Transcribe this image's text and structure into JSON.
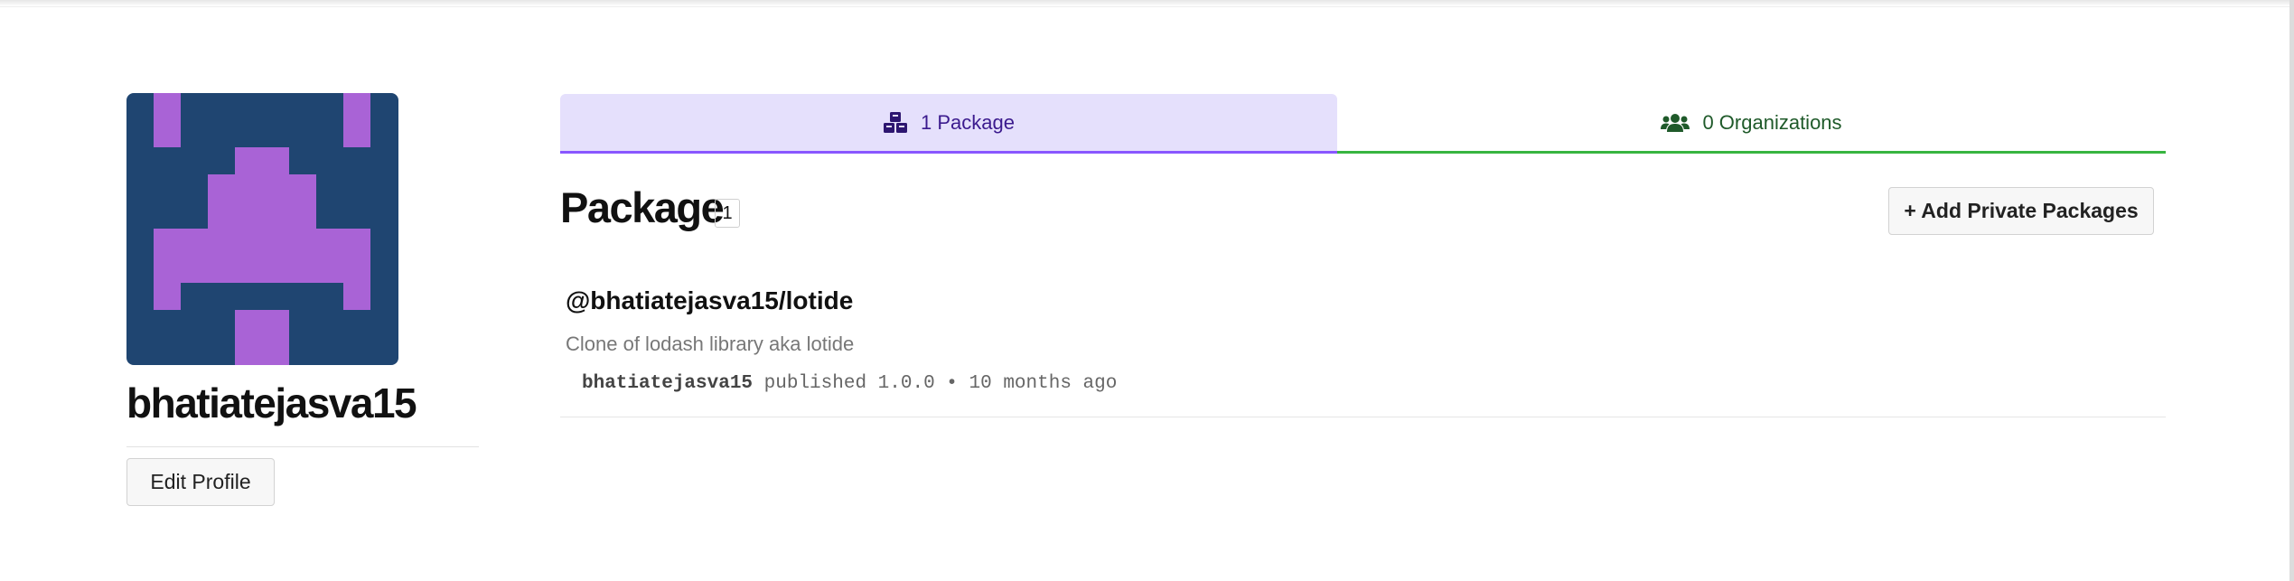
{
  "profile": {
    "username": "bhatiatejasva15",
    "edit_profile_label": "Edit Profile",
    "avatar_colors": {
      "background": "#1f4571",
      "foreground": "#a963d6"
    }
  },
  "tabs": [
    {
      "label": "1 Package",
      "icon": "cubes-icon",
      "active": true,
      "accent": "#8956ff"
    },
    {
      "label": "0 Organizations",
      "icon": "users-icon",
      "active": false,
      "accent": "#38b540"
    }
  ],
  "packages_section": {
    "title": "Package",
    "count": "1",
    "add_private_label": "+ Add Private Packages"
  },
  "packages": [
    {
      "name": "@bhatiatejasva15/lotide",
      "description": "Clone of lodash library aka lotide",
      "author": "bhatiatejasva15",
      "published_text": "published",
      "version": "1.0.0",
      "separator": "•",
      "time_ago": "10 months ago"
    }
  ]
}
